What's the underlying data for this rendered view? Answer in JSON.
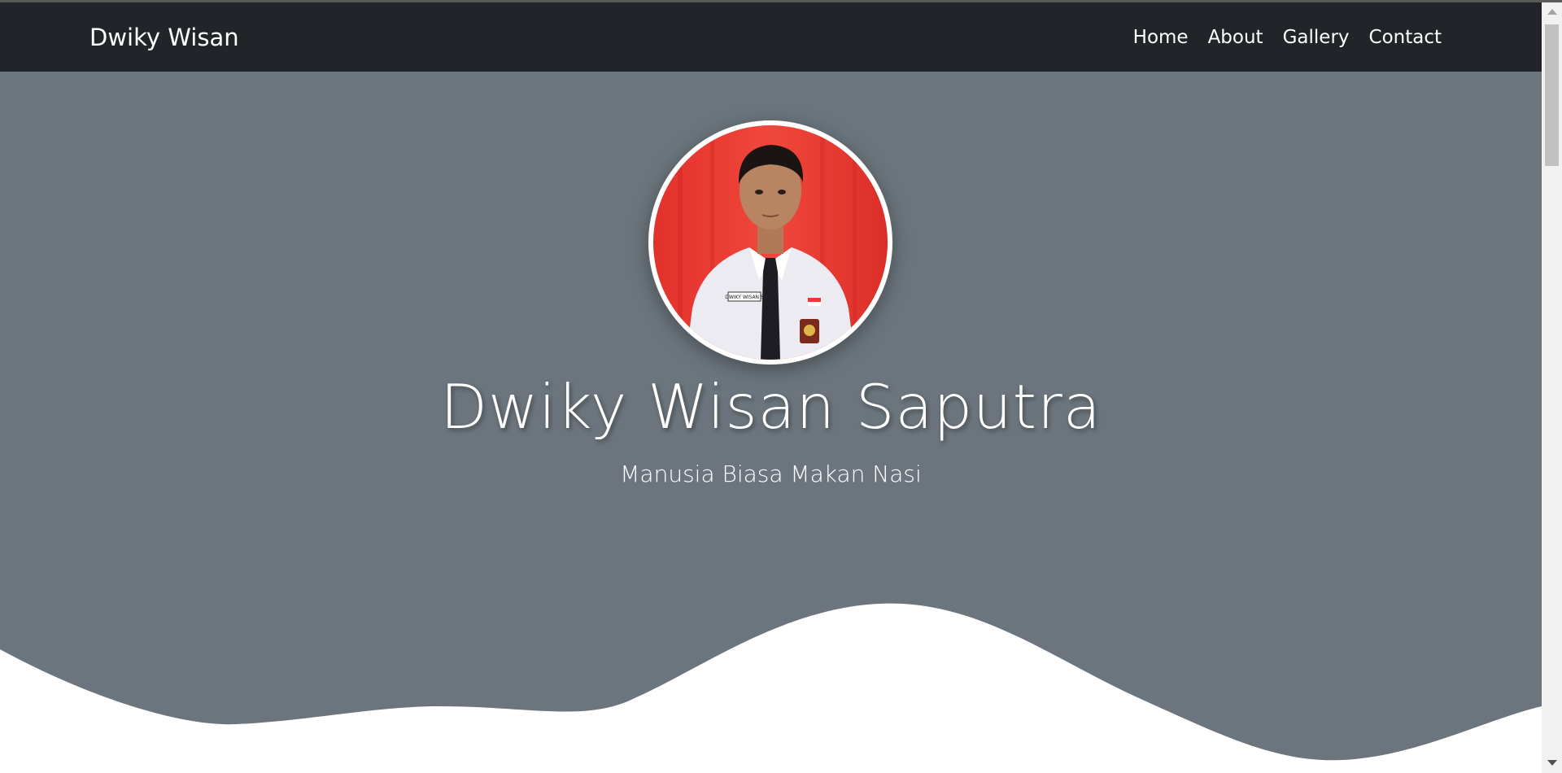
{
  "navbar": {
    "brand": "Dwiky Wisan",
    "links": [
      {
        "label": "Home"
      },
      {
        "label": "About"
      },
      {
        "label": "Gallery"
      },
      {
        "label": "Contact"
      }
    ]
  },
  "hero": {
    "title": "Dwiky Wisan Saputra",
    "subtitle": "Manusia Biasa Makan Nasi",
    "name_tag": "DWIKY WISAN S"
  },
  "colors": {
    "navbar_bg": "#212529",
    "hero_bg": "#6c757d",
    "wave_fill": "#ffffff",
    "avatar_bg": "#e8352e"
  },
  "icons": {
    "profile": "person-photo"
  }
}
